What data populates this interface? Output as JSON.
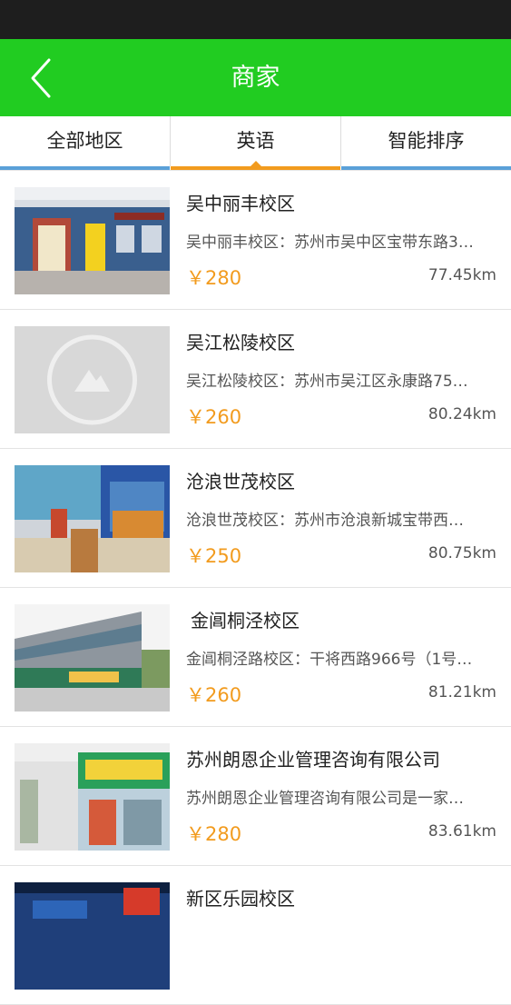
{
  "header": {
    "title": "商家",
    "back_icon": "chevron-left-icon",
    "bg_color": "#21cc21"
  },
  "filters": [
    {
      "label": "全部地区",
      "active": false
    },
    {
      "label": "英语",
      "active": true
    },
    {
      "label": "智能排序",
      "active": false
    }
  ],
  "accent_color": "#f29b1e",
  "merchants": [
    {
      "title": "吴中丽丰校区",
      "desc": "吴中丽丰校区：苏州市吴中区宝带东路3…",
      "price": "￥280",
      "distance": "77.45km",
      "image": "storefront-photo"
    },
    {
      "title": "吴江松陵校区",
      "desc": "吴江松陵校区：苏州市吴江区永康路75…",
      "price": "￥260",
      "distance": "80.24km",
      "image": "placeholder-image-icon"
    },
    {
      "title": "沧浪世茂校区",
      "desc": "沧浪世茂校区：苏州市沧浪新城宝带西…",
      "price": "￥250",
      "distance": "80.75km",
      "image": "storefront-photo"
    },
    {
      "title": "金阊桐泾校区",
      "desc": "金阊桐泾路校区：干将西路966号（1号…",
      "price": "￥260",
      "distance": "81.21km",
      "image": "building-photo"
    },
    {
      "title": "苏州朗恩企业管理咨询有限公司",
      "desc": "苏州朗恩企业管理咨询有限公司是一家…",
      "price": "￥280",
      "distance": "83.61km",
      "image": "building-photo"
    },
    {
      "title": "新区乐园校区",
      "desc": "",
      "price": "",
      "distance": "",
      "image": "storefront-photo"
    }
  ]
}
